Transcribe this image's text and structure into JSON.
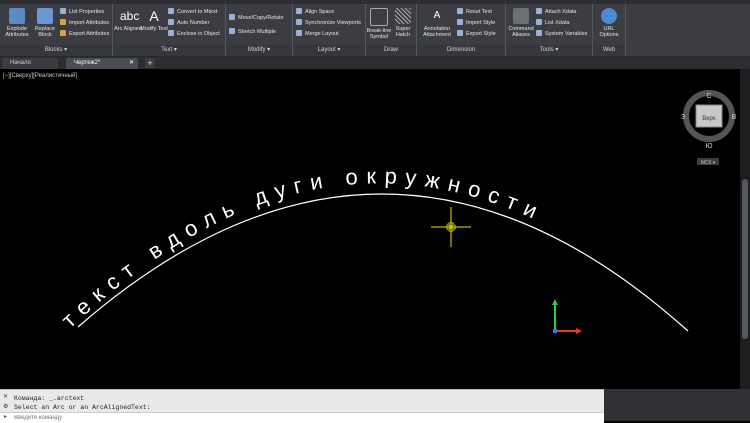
{
  "ribbon": {
    "panels": {
      "blocks": "Blocks ▾",
      "text": "Text ▾",
      "modify": "Modify ▾",
      "layout": "Layout ▾",
      "draw": "Draw",
      "dimension": "Dimension",
      "tools": "Tools ▾",
      "web": "Web"
    },
    "buttons": {
      "explode_attributes": "Explode Attributes",
      "replace_block": "Replace Block",
      "list_properties": "List Properties",
      "import_attributes": "Import Attributes",
      "export_attributes": "Export Attributes",
      "arc_aligned": "Arc Aligned",
      "modify_text": "Modify Text",
      "convert_to_mtext": "Convert to Mtext",
      "auto_number": "Auto Number",
      "enclose_in_object": "Enclose in Object",
      "move_copy_rotate": "Move/Copy/Rotate",
      "stretch_multiple": "Stretch Multiple",
      "align_space": "Align Space",
      "synchronize_viewports": "Synchronize Viewports",
      "merge_layout": "Merge Layout",
      "break_line_symbol": "Break-line Symbol",
      "super_hatch": "Super Hatch",
      "annotation_attachment": "Annotation Attachment",
      "reset_text": "Reset Text",
      "import_style": "Import Style",
      "export_style": "Export Style",
      "command_aliases": "Command Aliases",
      "attach_xdata": "Attach Xdata",
      "list_xdata": "List Xdata",
      "system_variables": "System Variables",
      "url_options": "URL Options"
    }
  },
  "tabs": [
    {
      "label": "Начало",
      "active": false
    },
    {
      "label": "Чертеж2*",
      "active": true
    }
  ],
  "viewport": {
    "label": "[−][Сверху][Реалистичный]",
    "arc_text": "текст вдоль дуги окружности",
    "viewcube": {
      "top_label": "Верх",
      "north": "С",
      "south": "Ю",
      "east": "В",
      "west": "З",
      "wcs": "МСК ▾"
    }
  },
  "command": {
    "line1": "Команда:  _.arctext",
    "line2": "Select an Arc or an ArcAlignedText:",
    "prompt_placeholder": "Введите команду"
  },
  "colors": {
    "arc": "#ffffff",
    "text": "#ffffff",
    "cursor": "#e8e400",
    "ucs_x": "#e8391d",
    "ucs_y": "#2ecc40"
  }
}
